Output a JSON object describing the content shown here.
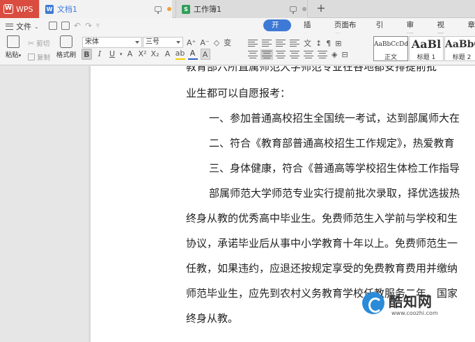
{
  "tabs": {
    "app_name": "WPS",
    "document_title": "文档1",
    "sheet_title": "工作簿1"
  },
  "menu": {
    "file_label": "文件",
    "ribbon_tabs": [
      "开始",
      "插入",
      "页面布局",
      "引用",
      "审阅",
      "视图",
      "章"
    ]
  },
  "toolbar": {
    "paste_label": "粘贴",
    "cut_label": "剪切",
    "copy_label": "复制",
    "format_painter_label": "格式刷",
    "font_name": "宋体",
    "font_size": "三号",
    "styles": [
      {
        "sample": "AaBbCcDd",
        "name": "正文"
      },
      {
        "sample": "AaBl",
        "name": "标题 1"
      },
      {
        "sample": "AaBbC",
        "name": "标题 2"
      }
    ]
  },
  "document": {
    "lines": [
      "教育部六所直属师范大学师范专业在各地都安排提前批",
      "业生都可以自愿报考：",
      "一、参加普通高校招生全国统一考试，达到部属师大在",
      "二、符合《教育部普通高校招生工作规定》，热爱教育",
      "三、身体健康，符合《普通高等学校招生体检工作指导",
      "部属师范大学师范专业实行提前批次录取，择优选拔热",
      "终身从教的优秀高中毕业生。免费师范生入学前与学校和生",
      "协议，承诺毕业后从事中小学教育十年以上。免费师范生一",
      "任教，如果违约，应退还按规定享受的免费教育费用并缴纳",
      "师范毕业生，应先到农村义务教育学校任教服务二年。国家",
      "终身从教。"
    ]
  },
  "watermark": {
    "name": "酷知网",
    "url": "www.coozhi.com"
  },
  "colors": {
    "wps_red": "#d94c3f",
    "accent_blue": "#3e79d6",
    "sheet_green": "#2f9e5a"
  }
}
